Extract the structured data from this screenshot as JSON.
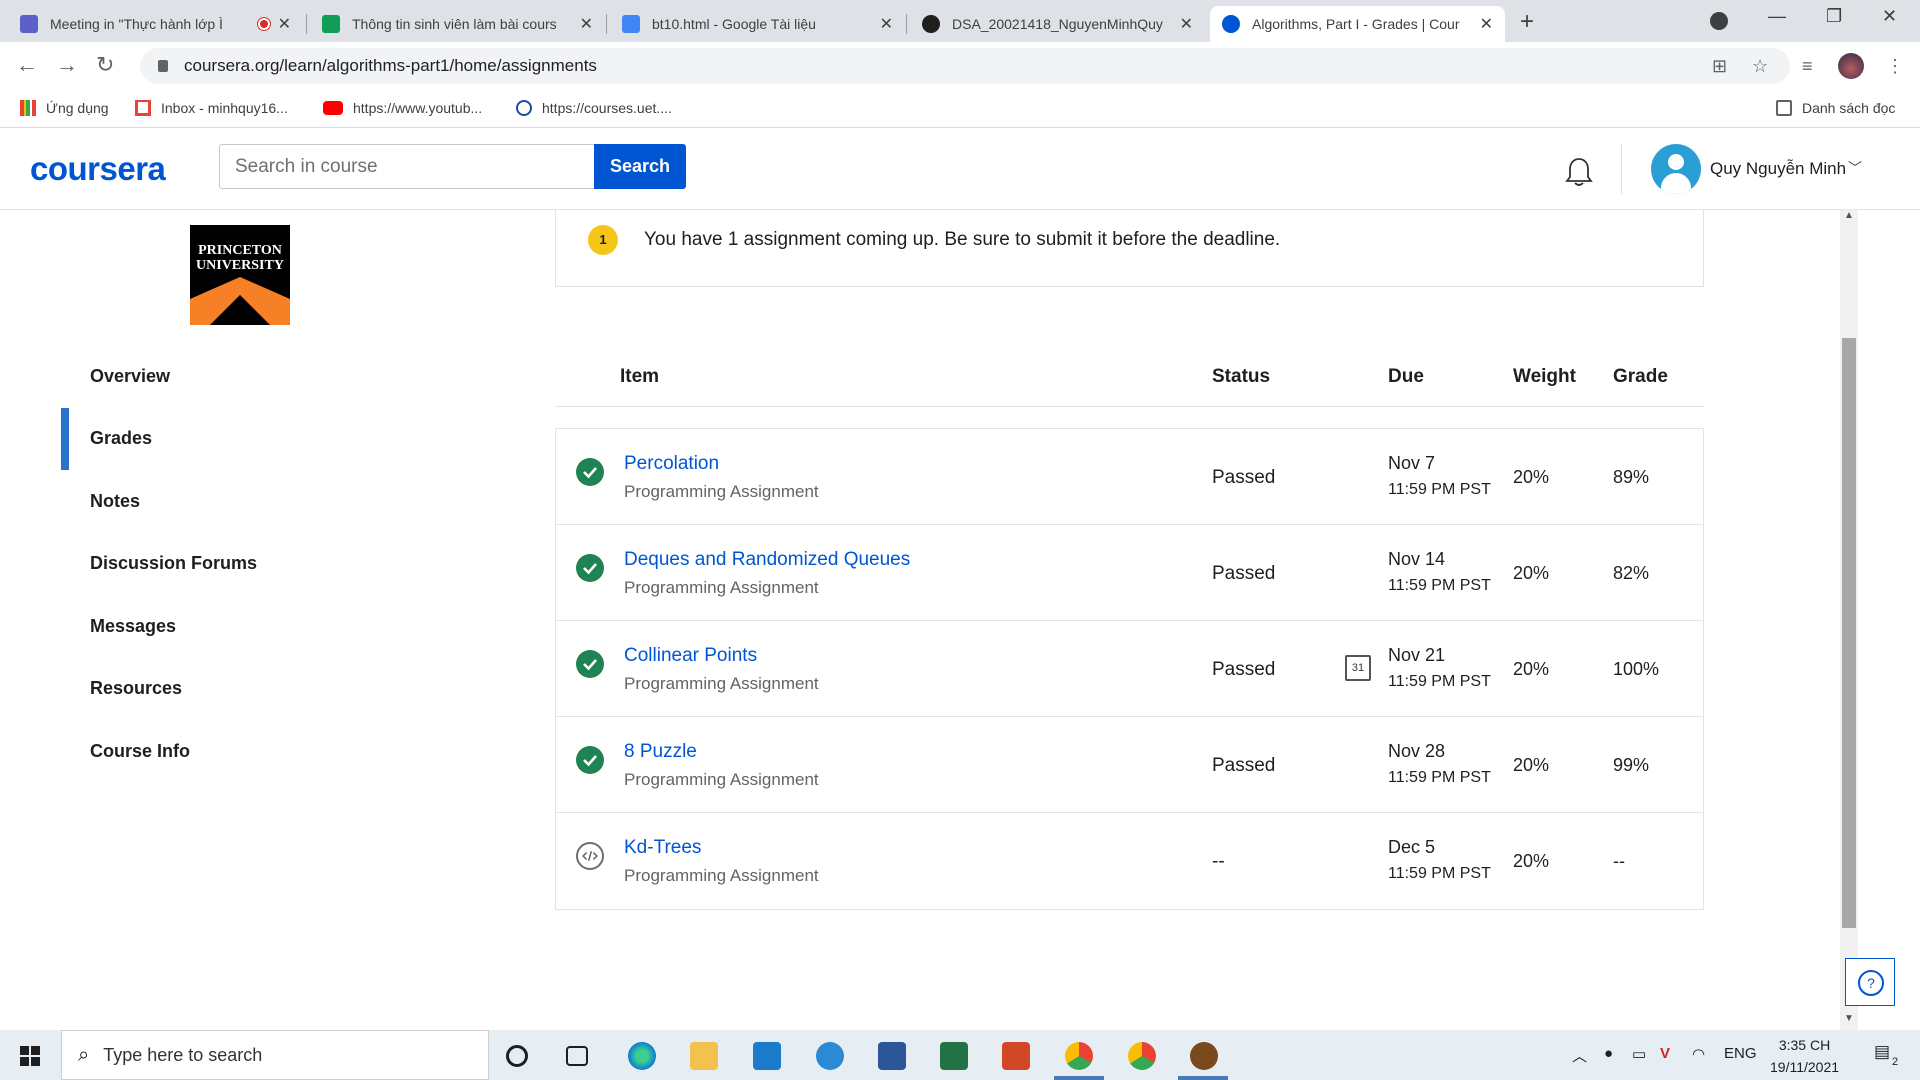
{
  "browser": {
    "tabs": [
      {
        "title": "Meeting in \"Thực hành lớp Ì",
        "icon": "teams-icon",
        "color": "#5b5fc7"
      },
      {
        "title": "Thông tin sinh viên làm bài cours",
        "icon": "sheets-icon",
        "color": "#0f9d58"
      },
      {
        "title": "bt10.html - Google Tài liệu",
        "icon": "docs-icon",
        "color": "#4285f4"
      },
      {
        "title": "DSA_20021418_NguyenMinhQuy",
        "icon": "github-icon",
        "color": "#1f1f1f"
      },
      {
        "title": "Algorithms, Part I - Grades | Cour",
        "icon": "coursera-icon",
        "color": "#0056d2"
      }
    ],
    "url": "coursera.org/learn/algorithms-part1/home/assignments",
    "bookmarks": [
      {
        "label": "Ứng dụng"
      },
      {
        "label": "Inbox - minhquy16..."
      },
      {
        "label": "https://www.youtub..."
      },
      {
        "label": "https://courses.uet...."
      }
    ],
    "reading_list": "Danh sách đọc"
  },
  "header": {
    "logo": "coursera",
    "search_placeholder": "Search in course",
    "search_button": "Search",
    "username": "Quy Nguyễn Minh"
  },
  "sidebar": {
    "university_lines": [
      "PRINCETON",
      "UNIVERSITY"
    ],
    "items": [
      {
        "label": "Overview",
        "active": false
      },
      {
        "label": "Grades",
        "active": true
      },
      {
        "label": "Notes",
        "active": false
      },
      {
        "label": "Discussion Forums",
        "active": false
      },
      {
        "label": "Messages",
        "active": false
      },
      {
        "label": "Resources",
        "active": false
      },
      {
        "label": "Course Info",
        "active": false
      }
    ]
  },
  "notice": {
    "count": "1",
    "message": "You have 1 assignment coming up. Be sure to submit it before the deadline."
  },
  "table": {
    "headers": {
      "item": "Item",
      "status": "Status",
      "due": "Due",
      "weight": "Weight",
      "grade": "Grade"
    },
    "rows": [
      {
        "name": "Percolation",
        "type": "Programming Assignment",
        "status": "Passed",
        "due_date": "Nov 7",
        "due_time": "11:59 PM PST",
        "weight": "20%",
        "grade": "89%",
        "state": "passed"
      },
      {
        "name": "Deques and Randomized Queues",
        "type": "Programming Assignment",
        "status": "Passed",
        "due_date": "Nov 14",
        "due_time": "11:59 PM PST",
        "weight": "20%",
        "grade": "82%",
        "state": "passed"
      },
      {
        "name": "Collinear Points",
        "type": "Programming Assignment",
        "status": "Passed",
        "due_date": "Nov 21",
        "due_time": "11:59 PM PST",
        "weight": "20%",
        "grade": "100%",
        "state": "passed",
        "calendar": "31"
      },
      {
        "name": "8 Puzzle",
        "type": "Programming Assignment",
        "status": "Passed",
        "due_date": "Nov 28",
        "due_time": "11:59 PM PST",
        "weight": "20%",
        "grade": "99%",
        "state": "passed"
      },
      {
        "name": "Kd-Trees",
        "type": "Programming Assignment",
        "status": "--",
        "due_date": "Dec 5",
        "due_time": "11:59 PM PST",
        "weight": "20%",
        "grade": "--",
        "state": "open"
      }
    ]
  },
  "help": {
    "label": "?"
  },
  "taskbar": {
    "search_placeholder": "Type here to search",
    "language": "ENG",
    "time": "3:35 CH",
    "date": "19/11/2021",
    "notifications": "2"
  },
  "colors": {
    "accent": "#0056d2",
    "pass": "#1f8354",
    "badge": "#f5c518",
    "active_bar": "#2a73cc"
  }
}
